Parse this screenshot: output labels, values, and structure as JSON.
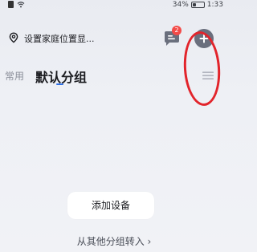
{
  "status_bar": {
    "battery_text": "34%",
    "battery_level": 0.34,
    "time": "1:33"
  },
  "header": {
    "location_text": "设置家庭位置显...",
    "message_badge_count": "2"
  },
  "tabs": {
    "common_label": "常用",
    "default_group_label": "默认分组"
  },
  "empty_state": {
    "add_device_label": "添加设备",
    "move_from_other_group_label": "从其他分组转入 ›"
  },
  "colors": {
    "accent": "#2f6fe4",
    "badge": "#f34b48",
    "annotation": "#e2242b"
  }
}
